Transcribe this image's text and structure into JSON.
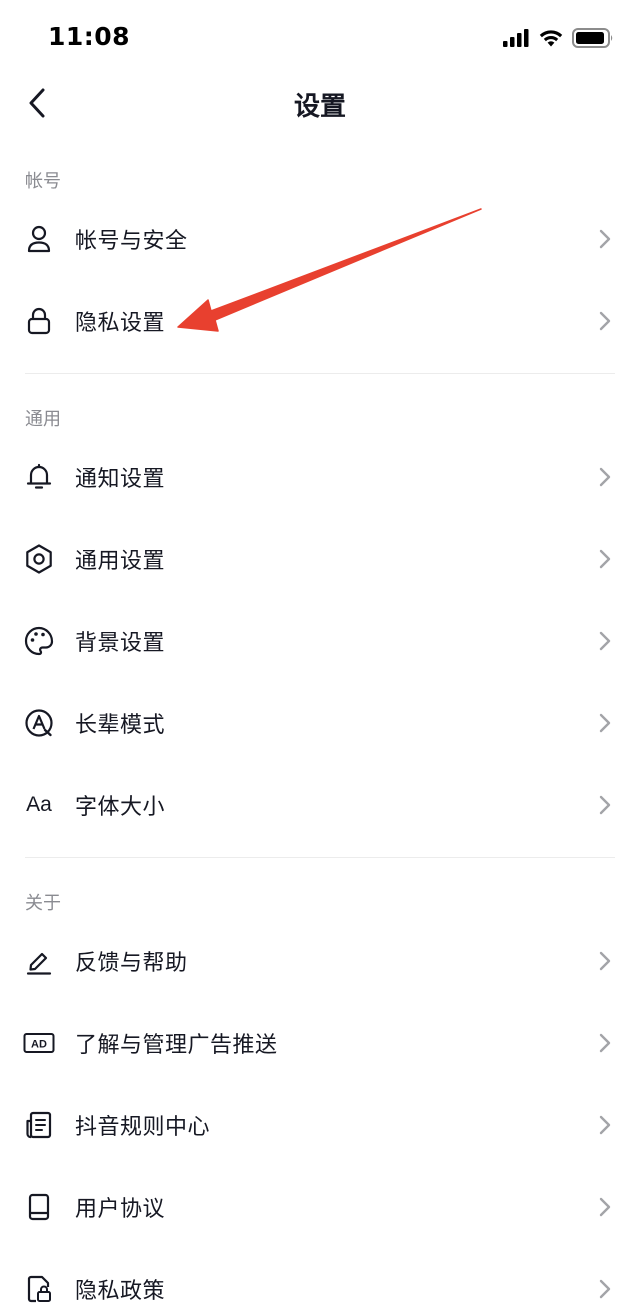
{
  "status_bar": {
    "time": "11:08"
  },
  "nav": {
    "title": "设置"
  },
  "sections": {
    "account": {
      "title": "帐号",
      "items": [
        {
          "label": "帐号与安全",
          "icon": "person-icon"
        },
        {
          "label": "隐私设置",
          "icon": "lock-icon"
        }
      ]
    },
    "general": {
      "title": "通用",
      "items": [
        {
          "label": "通知设置",
          "icon": "bell-icon"
        },
        {
          "label": "通用设置",
          "icon": "gear-icon"
        },
        {
          "label": "背景设置",
          "icon": "palette-icon"
        },
        {
          "label": "长辈模式",
          "icon": "elder-mode-icon"
        },
        {
          "label": "字体大小",
          "icon": "font-size-icon",
          "icon_text": "Aa"
        }
      ]
    },
    "about": {
      "title": "关于",
      "items": [
        {
          "label": "反馈与帮助",
          "icon": "pencil-icon"
        },
        {
          "label": "了解与管理广告推送",
          "icon": "ad-icon",
          "icon_text": "AD"
        },
        {
          "label": "抖音规则中心",
          "icon": "document-icon"
        },
        {
          "label": "用户协议",
          "icon": "book-icon"
        },
        {
          "label": "隐私政策",
          "icon": "privacy-policy-icon"
        }
      ]
    }
  },
  "colors": {
    "text": "#161823",
    "section_title": "#8a8b91",
    "chevron": "#a3a4a8",
    "annotation_arrow": "#e8402f"
  }
}
